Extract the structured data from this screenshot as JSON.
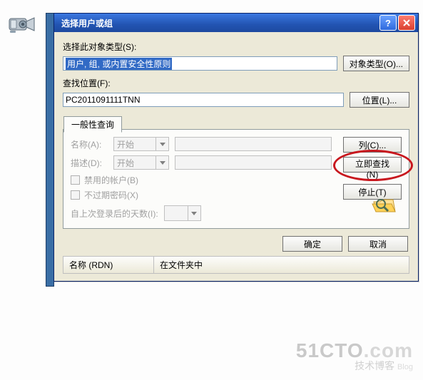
{
  "dialog": {
    "title": "选择用户或组",
    "object_type_label": "选择此对象类型(S):",
    "object_type_value": "用户, 组, 或内置安全性原则",
    "object_types_btn": "对象类型(O)...",
    "location_label": "查找位置(F):",
    "location_value": "PC2011091111TNN",
    "locations_btn": "位置(L)...",
    "tab_label": "一般性查询",
    "form": {
      "name_label": "名称(A):",
      "name_mode": "开始",
      "desc_label": "描述(D):",
      "desc_mode": "开始",
      "chk_disabled": "禁用的帐户(B)",
      "chk_noexpire": "不过期密码(X)",
      "days_label": "自上次登录后的天数(I):"
    },
    "side": {
      "columns_btn": "列(C)...",
      "find_now_btn": "立即查找(N)",
      "stop_btn": "停止(T)"
    },
    "ok_btn": "确定",
    "cancel_btn": "取消",
    "list": {
      "col1": "名称 (RDN)",
      "col2": "在文件夹中"
    }
  },
  "watermark": {
    "brand": "51CTO",
    "dot": ".com",
    "sub": "技术博客",
    "blog": "Blog"
  }
}
